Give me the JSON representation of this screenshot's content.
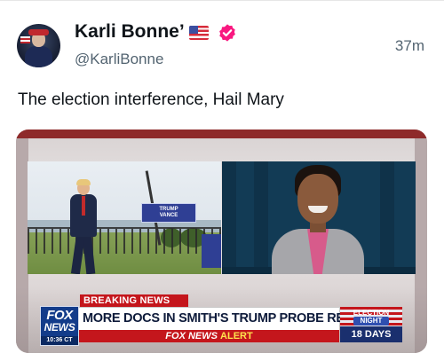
{
  "post": {
    "display_name": "Karli Bonne’",
    "handle": "@KarliBonne",
    "timestamp": "37m",
    "text": "The election interference, Hail Mary",
    "flag_emoji": "united-states-flag-icon",
    "verified_color": "#f91880"
  },
  "media": {
    "podium_sign": [
      "TRUMP",
      "VANCE"
    ],
    "chyron": {
      "breaking_label": "BREAKING NEWS",
      "network_line1": "FOX",
      "network_line2": "NEWS",
      "clock": "10:36 CT",
      "headline": "MORE DOCS IN SMITH'S TRUMP PROBE RELEASED",
      "alert_brand": "FOX NEWS",
      "alert_label": "ALERT",
      "election_title": "ELECTION",
      "election_night": "NIGHT",
      "election_days": "18 DAYS"
    },
    "colors": {
      "fox_blue": "#133c8a",
      "breaking_red": "#c4161c",
      "alert_yellow": "#ffe44d"
    }
  }
}
